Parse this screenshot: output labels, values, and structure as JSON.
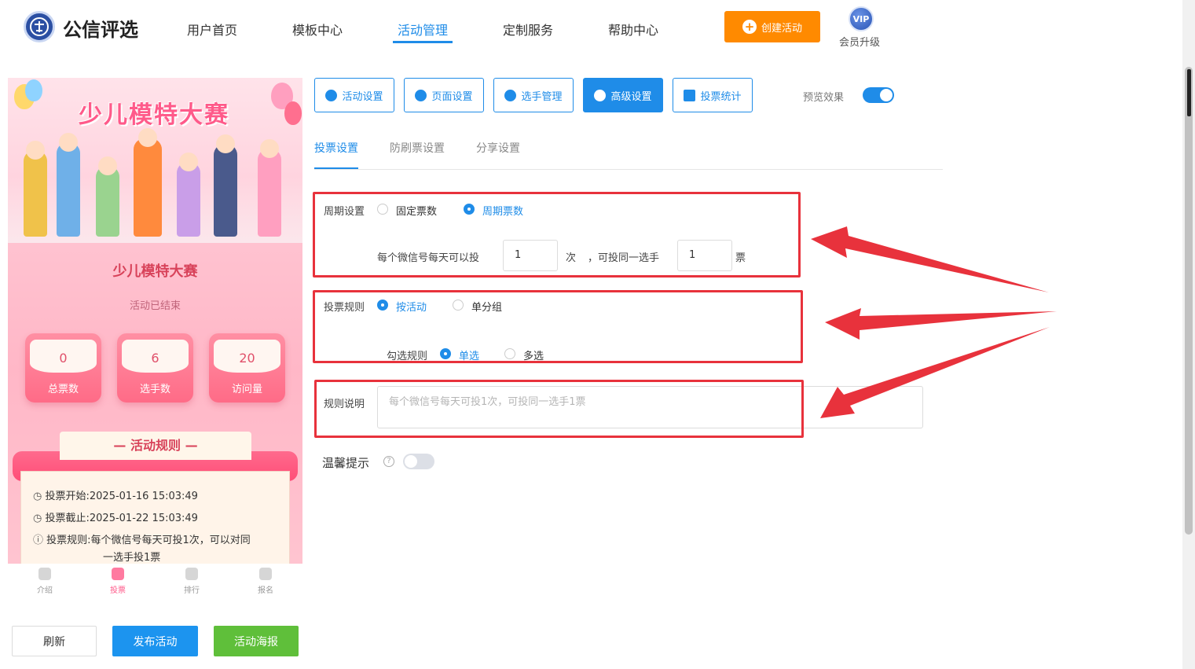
{
  "brand": {
    "name": "公信评选"
  },
  "nav": {
    "items": [
      "用户首页",
      "模板中心",
      "活动管理",
      "定制服务",
      "帮助中心"
    ],
    "active": "活动管理",
    "create_label": "创建活动",
    "vip_badge": "VIP",
    "vip_label": "会员升级"
  },
  "preview": {
    "banner_title": "少儿模特大赛",
    "title": "少儿模特大赛",
    "status": "活动已结束",
    "stats": [
      {
        "value": "0",
        "label": "总票数"
      },
      {
        "value": "6",
        "label": "选手数"
      },
      {
        "value": "20",
        "label": "访问量"
      }
    ],
    "rules_heading": "— 活动规则 —",
    "rules": [
      {
        "label": "投票开始:",
        "value": "2025-01-16 15:03:49"
      },
      {
        "label": "投票截止:",
        "value": "2025-01-22 15:03:49"
      },
      {
        "label": "投票规则:",
        "value": "每个微信号每天可投1次，可以对同",
        "value2": "一选手投1票"
      }
    ],
    "tabbar": [
      "介绍",
      "投票",
      "排行",
      "报名"
    ],
    "active_tab": "投票"
  },
  "bottom_buttons": {
    "refresh": "刷新",
    "publish": "发布活动",
    "poster": "活动海报"
  },
  "toolbar": {
    "buttons": [
      "活动设置",
      "页面设置",
      "选手管理",
      "高级设置",
      "投票统计"
    ],
    "active": "高级设置",
    "preview_label": "预览效果"
  },
  "subtabs": [
    "投票设置",
    "防刷票设置",
    "分享设置"
  ],
  "form": {
    "cycle": {
      "label": "周期设置",
      "options": [
        "固定票数",
        "周期票数"
      ],
      "selected": "周期票数"
    },
    "daily": {
      "prefix": "每个微信号每天可以投",
      "times_value": "1",
      "times_unit": "次",
      "mid": "，可投同一选手",
      "votes_value": "1",
      "votes_unit": "票"
    },
    "vote_rule": {
      "label": "投票规则",
      "options": [
        "按活动",
        "单分组"
      ],
      "selected": "按活动"
    },
    "check_rule": {
      "label": "勾选规则",
      "options": [
        "单选",
        "多选"
      ],
      "selected": "单选"
    },
    "desc": {
      "label": "规则说明",
      "placeholder": "每个微信号每天可投1次，可投同一选手1票"
    },
    "tip": {
      "label": "温馨提示",
      "help": "?"
    }
  },
  "colors": {
    "primary": "#1f8ce8",
    "create": "#ff8a00",
    "publish": "#1c94ef",
    "poster": "#5fbf3a",
    "highlight": "#e8323c"
  }
}
